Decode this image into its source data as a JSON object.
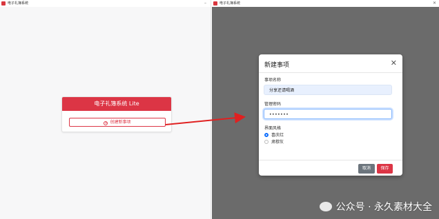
{
  "left_window": {
    "title": "电子礼簿系统",
    "min_glyph": "–",
    "card": {
      "header": "电子礼簿系统 Lite",
      "create_button": "创建新事项",
      "plus_glyph": "+"
    }
  },
  "right_window": {
    "title": "电子礼簿系统",
    "close_glyph": "✕",
    "modal": {
      "title": "新建事项",
      "close_glyph": "✕",
      "name_label": "事项名称",
      "name_value": "分享还请喝酒",
      "pwd_label": "管理密码",
      "pwd_value": "•••••••",
      "theme_label": "界面风格",
      "theme_options": [
        "喜庆红",
        "肃穆灰"
      ],
      "selected_theme": "喜庆红",
      "cancel_button": "取消",
      "save_button": "保存"
    }
  },
  "watermark": "公众号 · 永久素材大全",
  "colors": {
    "brand_red": "#dc3545",
    "overlay_gray": "#6b6b6b",
    "focus_blue": "#86b7fe",
    "arrow_red": "#e02020"
  },
  "icons": [
    "app-icon",
    "minimize-icon",
    "close-icon",
    "plus-circle-icon",
    "arrow-annotation-icon",
    "wechat-icon"
  ]
}
